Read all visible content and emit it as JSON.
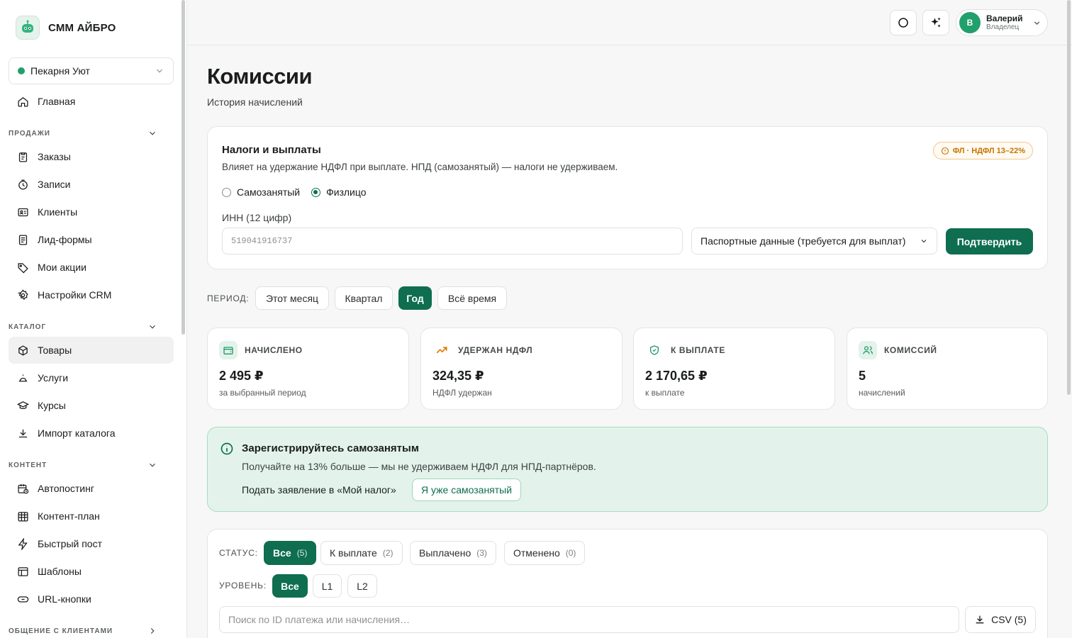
{
  "brand": {
    "name": "СММ АЙБРО",
    "logo_icon": "robot-icon"
  },
  "workspace": {
    "name": "Пекарня Уют",
    "status_color": "#22a06b"
  },
  "sidebar": {
    "home": "Главная",
    "sections": [
      {
        "title": "ПРОДАЖИ",
        "items": [
          "Заказы",
          "Записи",
          "Клиенты",
          "Лид-формы",
          "Мои акции",
          "Настройки CRM"
        ]
      },
      {
        "title": "КАТАЛОГ",
        "items": [
          "Товары",
          "Услуги",
          "Курсы",
          "Импорт каталога"
        ]
      },
      {
        "title": "КОНТЕНТ",
        "items": [
          "Автопостинг",
          "Контент-план",
          "Быстрый пост",
          "Шаблоны",
          "URL-кнопки"
        ]
      },
      {
        "title": "ОБЩЕНИЕ С КЛИЕНТАМИ",
        "items": []
      }
    ],
    "active_item": "Товары"
  },
  "user": {
    "initial": "В",
    "name": "Валерий",
    "role": "Владелец"
  },
  "page": {
    "title": "Комиссии",
    "subtitle": "История начислений"
  },
  "tax": {
    "title": "Налоги и выплаты",
    "description": "Влияет на удержание НДФЛ при выплате. НПД (самозанятый) — налоги не удерживаем.",
    "badge": "ФЛ · НДФЛ 13–22%",
    "options": [
      "Самозанятый",
      "Физлицо"
    ],
    "selected": "Физлицо",
    "inn_label": "ИНН (12 цифр)",
    "inn_placeholder": "519041916737",
    "passport_label": "Паспортные данные (требуется для выплат)",
    "confirm_label": "Подтвердить"
  },
  "period": {
    "label": "ПЕРИОД:",
    "options": [
      "Этот месяц",
      "Квартал",
      "Год",
      "Всё время"
    ],
    "selected": "Год"
  },
  "stats": [
    {
      "title": "НАЧИСЛЕНО",
      "value": "2 495 ₽",
      "note": "за выбранный период",
      "icon": "wallet-icon"
    },
    {
      "title": "УДЕРЖАН НДФЛ",
      "value": "324,35 ₽",
      "note": "НДФЛ удержан",
      "icon": "trend-up-icon"
    },
    {
      "title": "К ВЫПЛАТЕ",
      "value": "2 170,65 ₽",
      "note": "к выплате",
      "icon": "shield-check-icon"
    },
    {
      "title": "КОМИССИЙ",
      "value": "5",
      "note": "начислений",
      "icon": "users-icon"
    }
  ],
  "promo": {
    "title": "Зарегистрируйтесь самозанятым",
    "text": "Получайте на 13% больше — мы не удерживаем НДФЛ для НПД-партнёров.",
    "link": "Подать заявление в «Мой налог»",
    "button": "Я уже самозанятый"
  },
  "filters": {
    "status_label": "СТАТУС:",
    "statuses": [
      {
        "label": "Все",
        "count": "(5)"
      },
      {
        "label": "К выплате",
        "count": "(2)"
      },
      {
        "label": "Выплачено",
        "count": "(3)"
      },
      {
        "label": "Отменено",
        "count": "(0)"
      }
    ],
    "level_label": "УРОВЕНЬ:",
    "levels": [
      "Все",
      "L1",
      "L2"
    ],
    "search_placeholder": "Поиск по ID платежа или начисления…",
    "csv_label": "CSV (5)"
  },
  "colors": {
    "accent": "#0e6e4f",
    "promo_bg": "#e3f3ec",
    "badge": "#c77500"
  }
}
